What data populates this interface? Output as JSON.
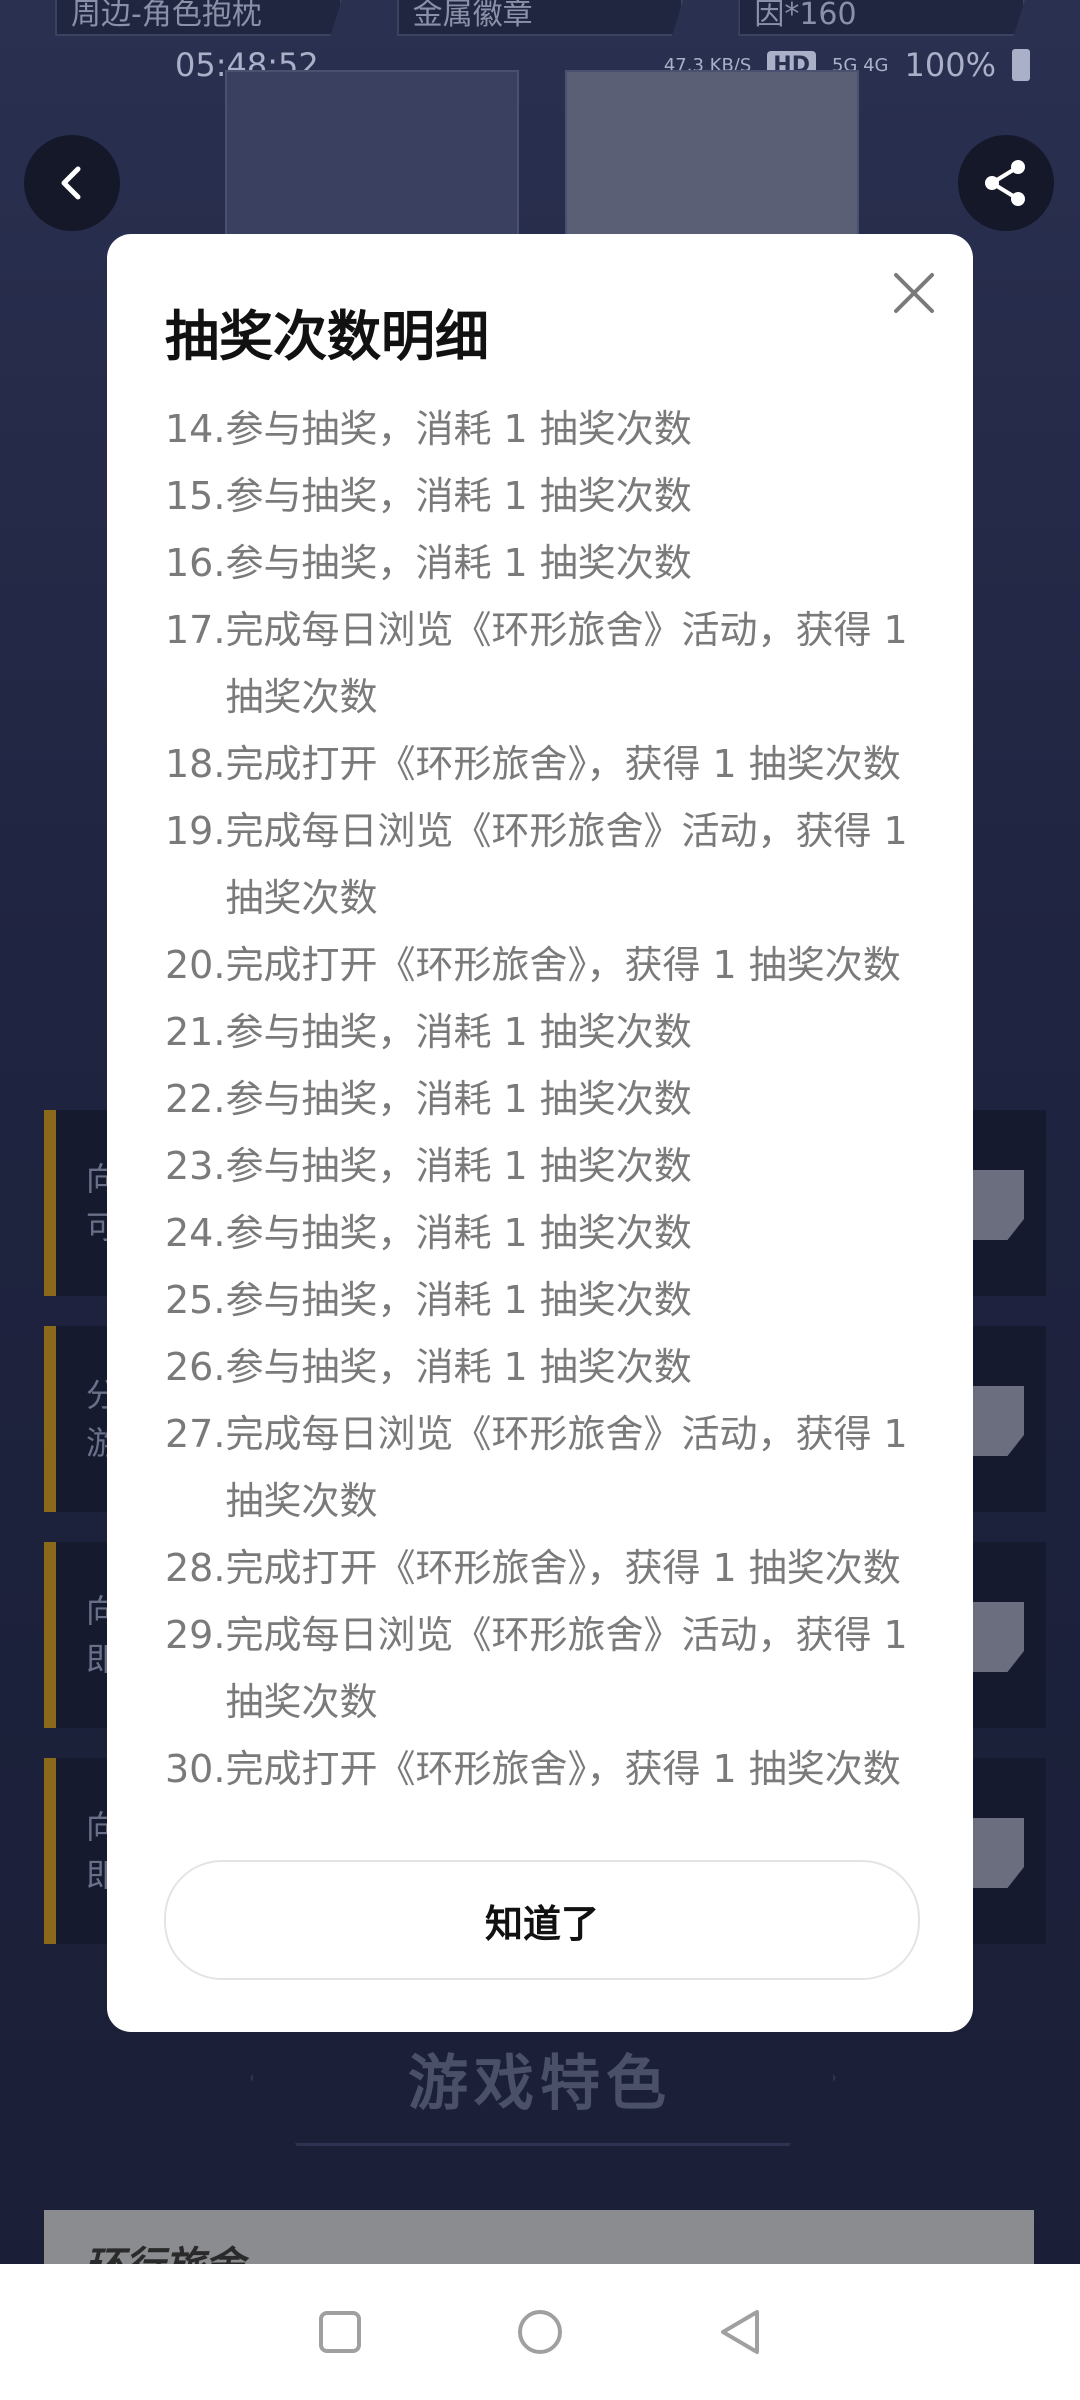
{
  "background": {
    "prize_tabs": [
      "周边-角色抱枕",
      "金属徽章",
      "因*160"
    ],
    "status": {
      "time": "05:48:52",
      "net_speed": "47.3 KB/S",
      "hd": "HD",
      "signal": "5G 4G",
      "battery": "100%"
    },
    "tasks": [
      {
        "chars": [
          "向",
          "可"
        ]
      },
      {
        "chars": [
          "分",
          "游"
        ]
      },
      {
        "chars": [
          "向",
          "即"
        ]
      },
      {
        "chars": [
          "向",
          "即"
        ]
      }
    ],
    "section_title": "游戏特色",
    "banner_text": "环行旅舍"
  },
  "dialog": {
    "title": "抽奖次数明细",
    "records": [
      {
        "num": "14.",
        "text": "参与抽奖，消耗 1 抽奖次数",
        "wrap": false
      },
      {
        "num": "15.",
        "text": "参与抽奖，消耗 1 抽奖次数",
        "wrap": false
      },
      {
        "num": "16.",
        "text": "参与抽奖，消耗 1 抽奖次数",
        "wrap": false
      },
      {
        "num": "17.",
        "text": "完成每日浏览《环形旅舍》活动，获得 1 抽奖次数",
        "wrap": true
      },
      {
        "num": "18.",
        "text": "完成打开《环形旅舍》，获得 1 抽奖次数",
        "wrap": false
      },
      {
        "num": "19.",
        "text": "完成每日浏览《环形旅舍》活动，获得 1 抽奖次数",
        "wrap": true
      },
      {
        "num": "20.",
        "text": "完成打开《环形旅舍》，获得 1 抽奖次数",
        "wrap": false
      },
      {
        "num": "21.",
        "text": "参与抽奖，消耗 1 抽奖次数",
        "wrap": false
      },
      {
        "num": "22.",
        "text": "参与抽奖，消耗 1 抽奖次数",
        "wrap": false
      },
      {
        "num": "23.",
        "text": "参与抽奖，消耗 1 抽奖次数",
        "wrap": false
      },
      {
        "num": "24.",
        "text": "参与抽奖，消耗 1 抽奖次数",
        "wrap": false
      },
      {
        "num": "25.",
        "text": "参与抽奖，消耗 1 抽奖次数",
        "wrap": false
      },
      {
        "num": "26.",
        "text": "参与抽奖，消耗 1 抽奖次数",
        "wrap": false
      },
      {
        "num": "27.",
        "text": "完成每日浏览《环形旅舍》活动，获得 1 抽奖次数",
        "wrap": true
      },
      {
        "num": "28.",
        "text": "完成打开《环形旅舍》，获得 1 抽奖次数",
        "wrap": false
      },
      {
        "num": "29.",
        "text": "完成每日浏览《环形旅舍》活动，获得 1 抽奖次数",
        "wrap": true
      },
      {
        "num": "30.",
        "text": "完成打开《环形旅舍》，获得 1 抽奖次数",
        "wrap": false
      }
    ],
    "confirm_label": "知道了"
  },
  "icons": {
    "back": "chevron-left-icon",
    "share": "share-icon",
    "close": "close-icon",
    "sys_recent": "square-icon",
    "sys_home": "circle-icon",
    "sys_back": "triangle-back-icon"
  },
  "colors": {
    "overlay": "#1c2038",
    "dialog_bg": "#ffffff",
    "record_text": "#7a7a7a",
    "title_text": "#111111"
  }
}
